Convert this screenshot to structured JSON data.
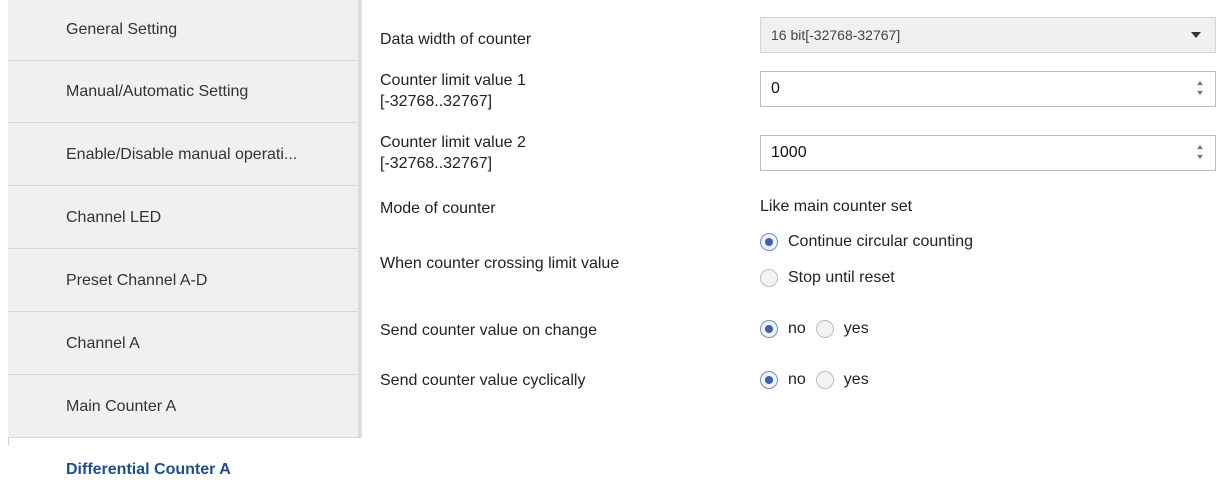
{
  "sidebar": {
    "items": [
      {
        "label": "General Setting"
      },
      {
        "label": "Manual/Automatic Setting"
      },
      {
        "label": "Enable/Disable manual operati..."
      },
      {
        "label": "Channel LED"
      },
      {
        "label": "Preset Channel A-D"
      },
      {
        "label": "Channel A"
      },
      {
        "label": "Main Counter A"
      },
      {
        "label": "Differential Counter A"
      }
    ],
    "active_index": 7
  },
  "form": {
    "data_width": {
      "label": "Data width of counter",
      "value": "16 bit[-32768-32767]"
    },
    "limit1": {
      "label_line1": "Counter limit value 1",
      "label_line2": "[-32768..32767]",
      "value": "0"
    },
    "limit2": {
      "label_line1": "Counter limit value 2",
      "label_line2": "[-32768..32767]",
      "value": "1000"
    },
    "mode": {
      "label": "Mode of counter",
      "value": "Like main counter set"
    },
    "crossing": {
      "label": "When counter crossing limit value",
      "options": [
        "Continue circular counting",
        "Stop until reset"
      ],
      "selected": 0
    },
    "send_change": {
      "label": "Send counter value on change",
      "options": [
        "no",
        "yes"
      ],
      "selected": 0
    },
    "send_cyclic": {
      "label": "Send counter value cyclically",
      "options": [
        "no",
        "yes"
      ],
      "selected": 0
    }
  },
  "colors": {
    "active_item": "#1f4e8c",
    "sidebar_bg": "#f0f0f0",
    "radio_dot": "#3f5fa8"
  }
}
